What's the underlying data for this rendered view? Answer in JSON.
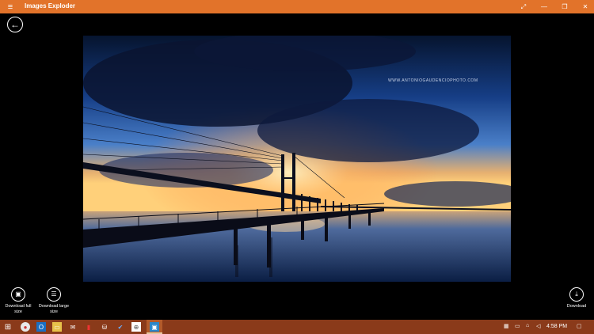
{
  "window": {
    "title": "Images Exploder",
    "menu_glyph": "≡",
    "maximize_glyph": "⤢",
    "minimize_glyph": "—",
    "restore_glyph": "❐",
    "close_glyph": "✕",
    "accent": "#e2732a"
  },
  "nav": {
    "back_glyph": "←"
  },
  "photo": {
    "watermark": "WWW.ANTONIOGAUDENCIOPHOTO.COM"
  },
  "actions": {
    "download_full": "Download full size",
    "download_large": "Download large size",
    "download": "Download"
  },
  "taskbar": {
    "start_glyph": "⊞",
    "apps": [
      "chrome-icon",
      "outlook-icon",
      "file-explorer-icon",
      "mail-icon",
      "app-icon",
      "store-icon",
      "app-icon",
      "visual-studio-icon",
      "images-exploder-icon"
    ],
    "clock": "4:58 PM",
    "color": "#8a3a1a"
  }
}
